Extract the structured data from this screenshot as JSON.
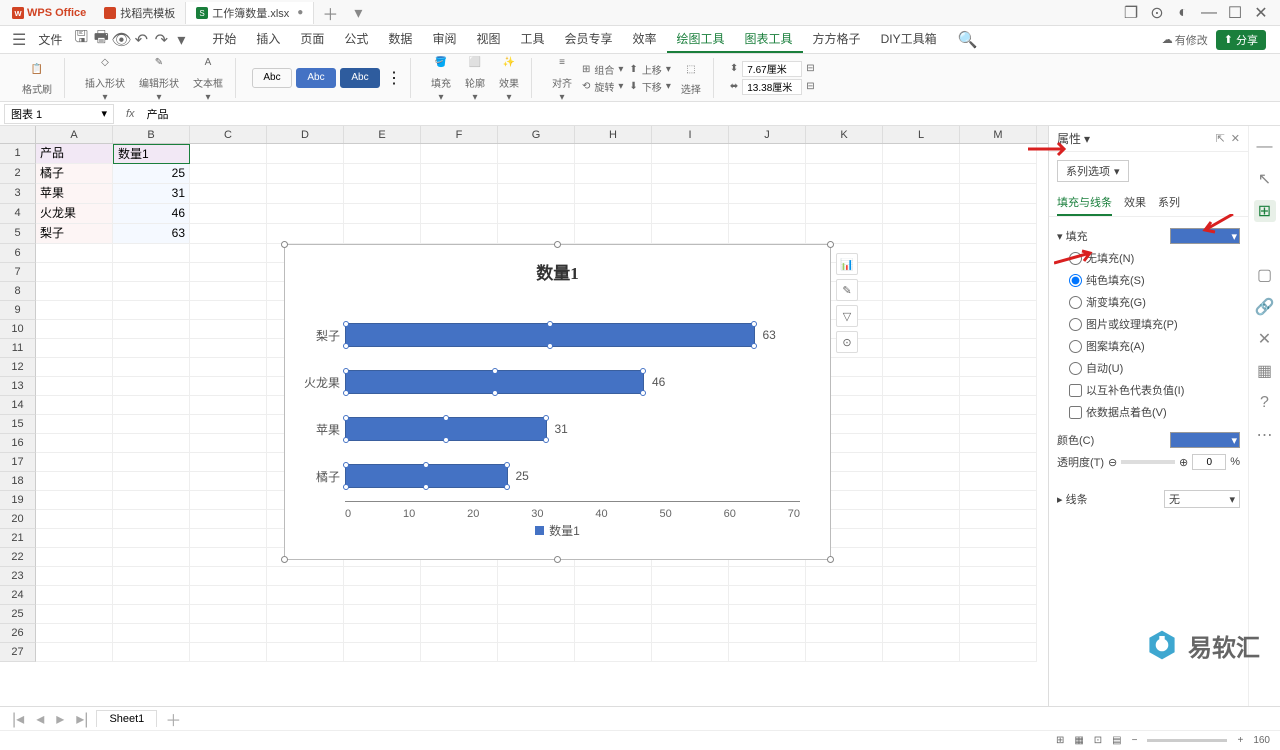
{
  "app": {
    "name": "WPS Office"
  },
  "tabs": [
    {
      "label": "找稻壳模板",
      "icon": "doc",
      "closeable": false
    },
    {
      "label": "工作簿数量.xlsx",
      "icon": "sheet",
      "dirty": true
    }
  ],
  "menu": {
    "file": "文件",
    "items": [
      "开始",
      "插入",
      "页面",
      "公式",
      "数据",
      "审阅",
      "视图",
      "工具",
      "会员专享",
      "效率"
    ],
    "active_items": [
      "绘图工具",
      "图表工具"
    ],
    "extra": [
      "方方格子",
      "DIY工具箱"
    ],
    "has_changes": "有修改",
    "share": "分享"
  },
  "ribbon": {
    "format_brush": "格式刷",
    "insert_shape": "插入形状",
    "edit_shape": "编辑形状",
    "textbox": "文本框",
    "style_chip": "Abc",
    "fill": "填充",
    "outline": "轮廓",
    "effect": "效果",
    "align": "对齐",
    "group": "组合",
    "move_up": "上移",
    "rotate": "旋转",
    "move_down": "下移",
    "select": "选择",
    "height": "7.67厘米",
    "width": "13.38厘米"
  },
  "namebox": "图表 1",
  "fx": "fx",
  "formula": "产品",
  "columns": [
    "A",
    "B",
    "C",
    "D",
    "E",
    "F",
    "G",
    "H",
    "I",
    "J",
    "K",
    "L",
    "M"
  ],
  "grid": {
    "headers": {
      "A": "产品",
      "B": "数量1"
    },
    "rows": [
      {
        "A": "橘子",
        "B": 25
      },
      {
        "A": "苹果",
        "B": 31
      },
      {
        "A": "火龙果",
        "B": 46
      },
      {
        "A": "梨子",
        "B": 63
      }
    ]
  },
  "chart_data": {
    "type": "bar",
    "title": "数量1",
    "categories": [
      "梨子",
      "火龙果",
      "苹果",
      "橘子"
    ],
    "values": [
      63,
      46,
      31,
      25
    ],
    "x_ticks": [
      0,
      10,
      20,
      30,
      40,
      50,
      60,
      70
    ],
    "xlim": [
      0,
      70
    ],
    "legend": "数量1",
    "color": "#4472c4"
  },
  "properties": {
    "title": "属性",
    "series_options": "系列选项",
    "tabs": {
      "fill_line": "填充与线条",
      "effect": "效果",
      "series": "系列"
    },
    "fill_section": "填充",
    "fill_options": {
      "none": "无填充(N)",
      "solid": "纯色填充(S)",
      "gradient": "渐变填充(G)",
      "picture": "图片或纹理填充(P)",
      "pattern": "图案填充(A)",
      "auto": "自动(U)"
    },
    "complement": "以互补色代表负值(I)",
    "by_point": "依数据点着色(V)",
    "color_label": "颜色(C)",
    "color_value": "#4472c4",
    "transparency_label": "透明度(T)",
    "transparency_value": 0,
    "transparency_unit": "%",
    "line_section": "线条",
    "line_value": "无"
  },
  "sheet_tab": "Sheet1",
  "status": {
    "zoom": 160
  },
  "watermark": "易软汇"
}
